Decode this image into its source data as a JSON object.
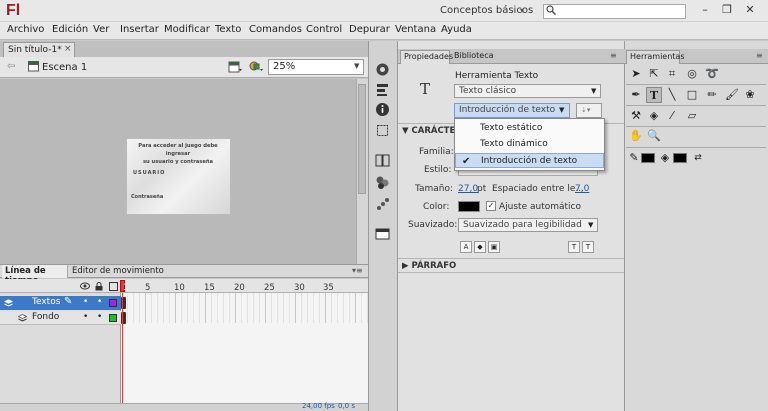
{
  "app": {
    "logo": "Fl",
    "workspace": "Conceptos básicos",
    "search_value": ""
  },
  "window": {
    "minimize": "–",
    "restore": "❐",
    "close": "✕"
  },
  "menu": [
    "Archivo",
    "Edición",
    "Ver",
    "Insertar",
    "Modificar",
    "Texto",
    "Comandos",
    "Control",
    "Depurar",
    "Ventana",
    "Ayuda"
  ],
  "document": {
    "tab_title": "Sin título-1*",
    "tab_close": "×",
    "scene_label": "Escena 1",
    "zoom": "25%"
  },
  "stage": {
    "heading_line1": "Para acceder al juego debe ingresar",
    "heading_line2": "su usuario y contraseña",
    "usuario": "USUARIO",
    "password": "Contraseña"
  },
  "timeline": {
    "tab_active": "Línea de tiempo",
    "tab_other": "Editor de movimiento",
    "frame_numbers": [
      "1",
      "5",
      "10",
      "15",
      "20",
      "25",
      "30",
      "35"
    ],
    "layers": [
      {
        "name": "Textos",
        "selected": true,
        "color": "#a020f0"
      },
      {
        "name": "Fondo",
        "selected": false,
        "color": "#22c022"
      }
    ],
    "fps": "24,00 fps",
    "time": "0,0 s"
  },
  "properties": {
    "tab_active": "Propiedades",
    "tab_other": "Biblioteca",
    "tool_name": "Herramienta Texto",
    "text_type": "Texto clásico",
    "text_behavior": "Introducción de texto",
    "section_character": "CARÁCTER",
    "family_label": "Familia:",
    "style_label": "Estilo:",
    "size_label": "Tamaño:",
    "size_value": "27,0",
    "size_unit": "pt",
    "spacing_label": "Espaciado entre le...",
    "spacing_value": "7,0",
    "color_label": "Color:",
    "autokern_label": "Ajuste automático",
    "autokern_checked": true,
    "aa_label": "Suavizado:",
    "aa_value": "Suavizado para legibilidad",
    "section_paragraph": "PÁRRAFO"
  },
  "popup": {
    "items": [
      "Texto estático",
      "Texto dinámico",
      "Introducción de texto"
    ],
    "selected_index": 2
  },
  "tools": {
    "tab": "Herramientas"
  }
}
